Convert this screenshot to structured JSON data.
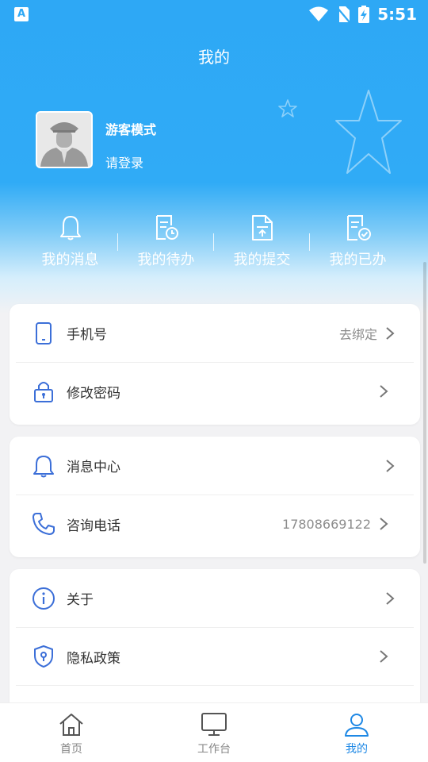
{
  "status_bar": {
    "time": "5:51",
    "app_icon_letter": "A"
  },
  "header": {
    "title": "我的"
  },
  "profile": {
    "name": "游客模式",
    "subtitle": "请登录"
  },
  "quick_actions": [
    {
      "label": "我的消息",
      "icon": "bell-icon"
    },
    {
      "label": "我的待办",
      "icon": "todo-clock-icon"
    },
    {
      "label": "我的提交",
      "icon": "submit-doc-icon"
    },
    {
      "label": "我的已办",
      "icon": "done-doc-icon"
    }
  ],
  "account_card": {
    "phone": {
      "label": "手机号",
      "value": "去绑定",
      "icon": "phone-icon"
    },
    "password": {
      "label": "修改密码",
      "icon": "lock-icon"
    }
  },
  "service_card": {
    "messages": {
      "label": "消息中心",
      "icon": "bell-icon"
    },
    "hotline": {
      "label": "咨询电话",
      "value": "17808669122",
      "icon": "telephone-icon"
    }
  },
  "about_card": {
    "about": {
      "label": "关于",
      "icon": "info-icon"
    },
    "privacy": {
      "label": "隐私政策",
      "icon": "shield-icon"
    }
  },
  "bottom_nav": [
    {
      "label": "首页",
      "icon": "home-icon",
      "active": false
    },
    {
      "label": "工作台",
      "icon": "monitor-icon",
      "active": false
    },
    {
      "label": "我的",
      "icon": "user-icon",
      "active": true
    }
  ],
  "colors": {
    "primary": "#2ea8f5",
    "accent": "#1e88e5",
    "icon_blue": "#3c6fd8"
  }
}
